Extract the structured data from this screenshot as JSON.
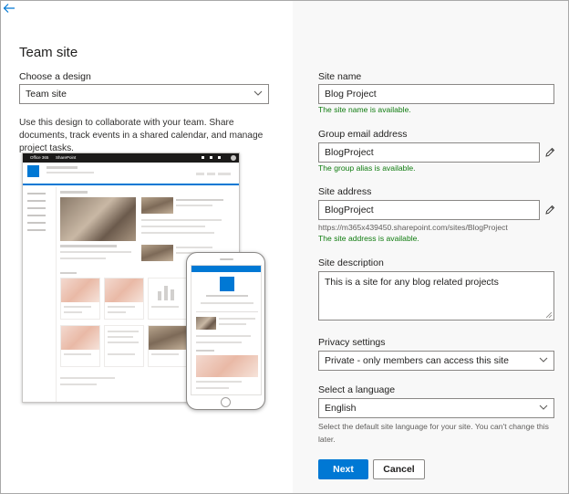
{
  "icons": {
    "back": "back-arrow-icon",
    "chevron": "chevron-down-icon",
    "edit": "pencil-icon"
  },
  "colors": {
    "accent": "#0078d4",
    "success": "#107c10",
    "right_panel_bg": "#f8f8f8"
  },
  "left_panel": {
    "title": "Team site",
    "design_label": "Choose a design",
    "design_value": "Team site",
    "description": "Use this design to collaborate with your team. Share documents, track events in a shared calendar, and manage project tasks.",
    "preview": {
      "suite_brand": "Office 365",
      "suite_app": "SharePoint"
    }
  },
  "form": {
    "site_name": {
      "label": "Site name",
      "value": "Blog Project",
      "status": "The site name is available."
    },
    "group_email": {
      "label": "Group email address",
      "value": "BlogProject",
      "status": "The group alias is available."
    },
    "site_address": {
      "label": "Site address",
      "value": "BlogProject",
      "url": "https://m365x439450.sharepoint.com/sites/BlogProject",
      "status": "The site address is available."
    },
    "site_description": {
      "label": "Site description",
      "value": "This is a site for any blog related projects"
    },
    "privacy": {
      "label": "Privacy settings",
      "value": "Private - only members can access this site"
    },
    "language": {
      "label": "Select a language",
      "value": "English",
      "hint": "Select the default site language for your site. You can't change this later."
    }
  },
  "buttons": {
    "next": "Next",
    "cancel": "Cancel"
  }
}
